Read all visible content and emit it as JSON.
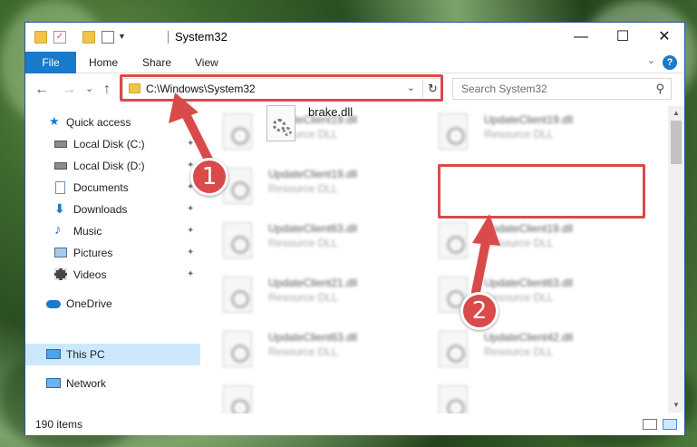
{
  "window": {
    "title": "System32",
    "minimize_glyph": "—",
    "maximize_glyph": "☐",
    "close_glyph": "✕"
  },
  "ribbon": {
    "tabs": [
      "File",
      "Home",
      "Share",
      "View"
    ],
    "help_glyph": "?",
    "collapse_glyph": "⌄"
  },
  "nav": {
    "back_glyph": "←",
    "forward_glyph": "→",
    "recent_glyph": "⌄",
    "up_glyph": "↑",
    "address": "C:\\Windows\\System32",
    "address_chevron": "⌄",
    "refresh_glyph": "↻",
    "search_placeholder": "Search System32",
    "search_glyph": "⚲"
  },
  "sidebar": {
    "items": [
      {
        "label": "Quick access",
        "icon": "star-icon"
      },
      {
        "label": "Local Disk (C:)",
        "icon": "drive-icon",
        "pinned": true
      },
      {
        "label": "Local Disk (D:)",
        "icon": "drive-icon",
        "pinned": true
      },
      {
        "label": "Documents",
        "icon": "document-icon",
        "pinned": true
      },
      {
        "label": "Downloads",
        "icon": "download-icon",
        "pinned": true
      },
      {
        "label": "Music",
        "icon": "music-icon",
        "pinned": true
      },
      {
        "label": "Pictures",
        "icon": "picture-icon",
        "pinned": true
      },
      {
        "label": "Videos",
        "icon": "video-icon",
        "pinned": true
      },
      {
        "label": "OneDrive",
        "icon": "cloud-icon"
      },
      {
        "label": "This PC",
        "icon": "computer-icon",
        "selected": true
      },
      {
        "label": "Network",
        "icon": "network-icon"
      }
    ],
    "pin_glyph": "📌"
  },
  "files": [
    {
      "name": "UpdateClient19.dll",
      "type": "Resource DLL"
    },
    {
      "name": "UpdateClient19.dll",
      "type": "Resource DLL"
    },
    {
      "name": "UpdateClient19.dll",
      "type": "Resource DLL"
    },
    {
      "name": "brake.dll",
      "type": ""
    },
    {
      "name": "UpdateClient63.dll",
      "type": "Resource DLL"
    },
    {
      "name": "UpdateClient19.dll",
      "type": "Resource DLL"
    },
    {
      "name": "UpdateClient21.dll",
      "type": "Resource DLL"
    },
    {
      "name": "UpdateClient63.dll",
      "type": "Resource DLL"
    },
    {
      "name": "UpdateClient63.dll",
      "type": "Resource DLL"
    },
    {
      "name": "UpdateClient42.dll",
      "type": "Resource DLL"
    }
  ],
  "status": {
    "item_count": "190 items"
  },
  "annotations": {
    "step1": "1",
    "step2": "2",
    "color": "#d94a4a"
  },
  "colors": {
    "accent": "#1979ca",
    "selection": "#cce8ff"
  }
}
